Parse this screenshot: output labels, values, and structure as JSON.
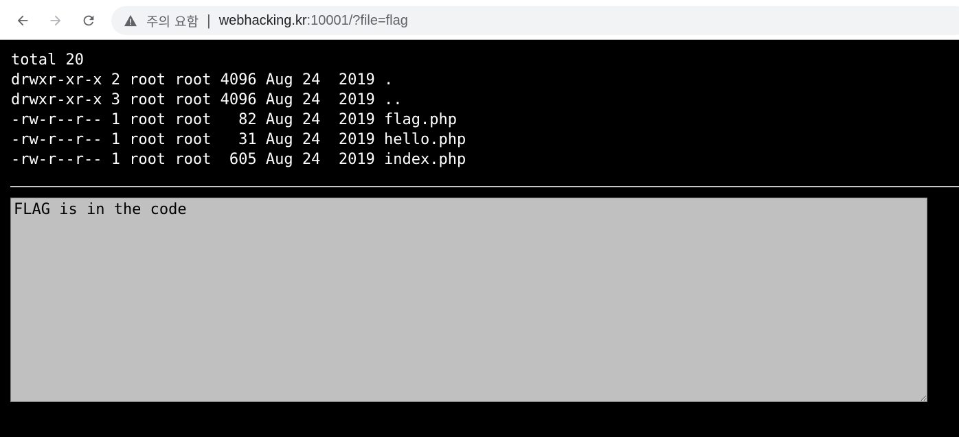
{
  "browser": {
    "security_label": "주의 요함",
    "separator": "|",
    "url_host": "webhacking.kr",
    "url_rest": ":10001/?file=flag"
  },
  "listing": {
    "lines": [
      "total 20",
      "drwxr-xr-x 2 root root 4096 Aug 24  2019 .",
      "drwxr-xr-x 3 root root 4096 Aug 24  2019 ..",
      "-rw-r--r-- 1 root root   82 Aug 24  2019 flag.php",
      "-rw-r--r-- 1 root root   31 Aug 24  2019 hello.php",
      "-rw-r--r-- 1 root root  605 Aug 24  2019 index.php"
    ]
  },
  "code_box": {
    "text": "FLAG is in the code"
  },
  "colors": {
    "page_background": "#000000",
    "textarea_background": "#c0c0c0",
    "divider": "#c8c8c8"
  },
  "icons": {
    "back": "arrow-left-icon",
    "forward": "arrow-right-icon",
    "reload": "reload-icon",
    "security": "warning-triangle-icon"
  }
}
